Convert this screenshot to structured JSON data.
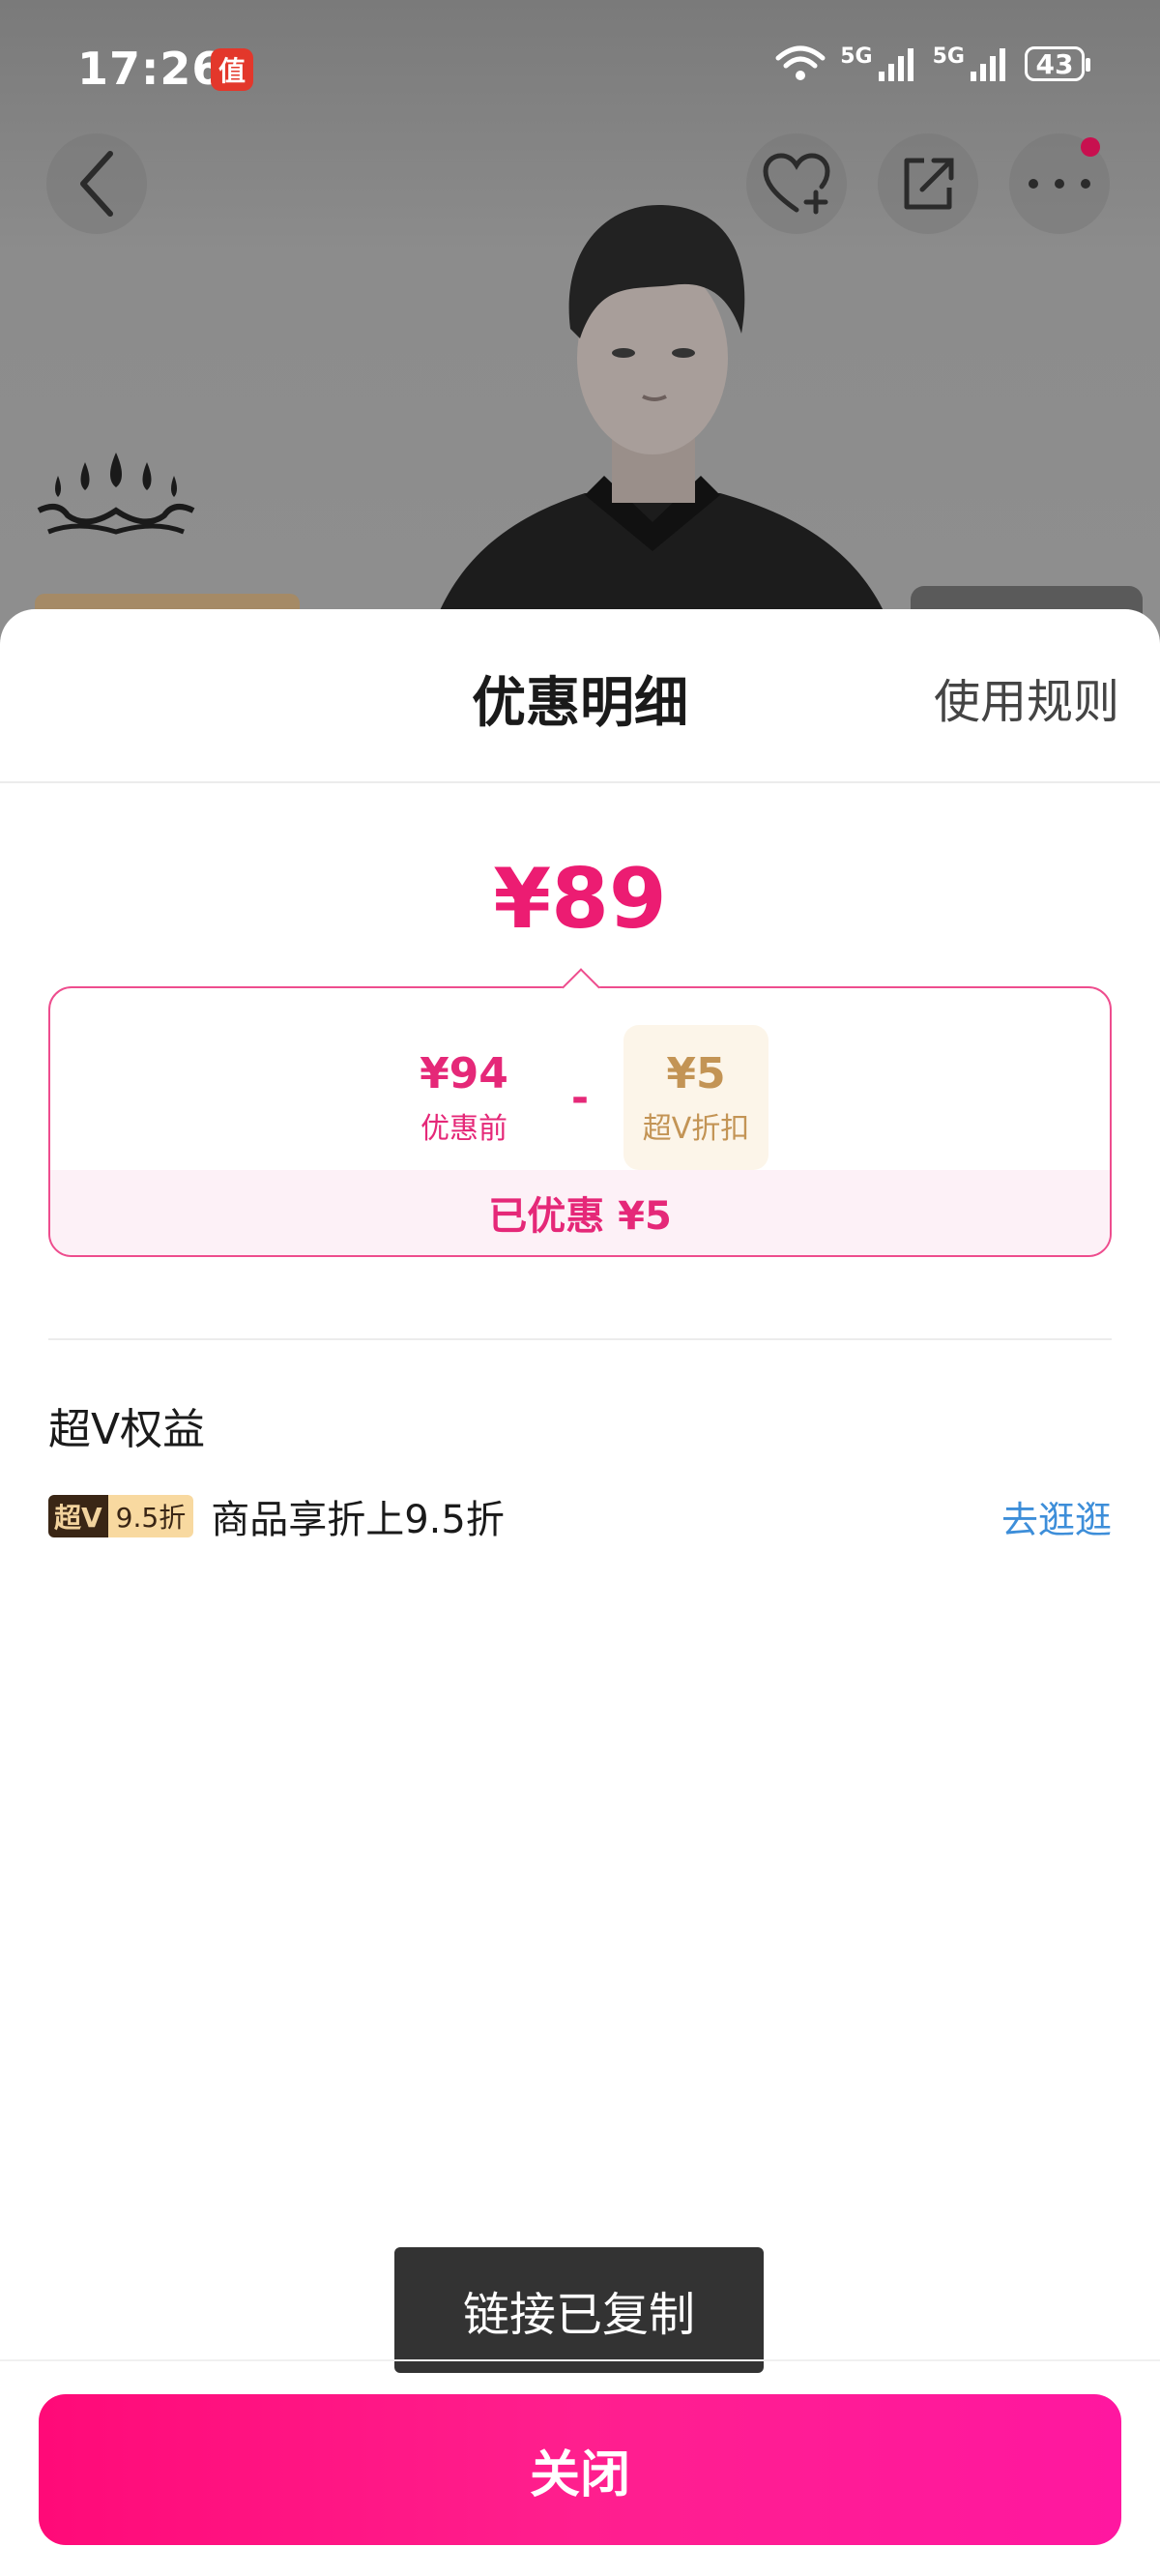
{
  "status_bar": {
    "time": "17:26",
    "app_badge": "值",
    "signal_1_label": "5G",
    "signal_2_label": "5G",
    "battery": "43"
  },
  "top_nav": {
    "icons": [
      "back-icon",
      "favorite-add-icon",
      "share-icon",
      "more-icon"
    ]
  },
  "sheet": {
    "title": "优惠明细",
    "rules_link": "使用规则",
    "final_price": "¥89",
    "breakdown": {
      "original_value": "¥94",
      "original_label": "优惠前",
      "operator": "-",
      "discount_value": "¥5",
      "discount_label": "超V折扣",
      "saved_text": "已优惠 ¥5"
    },
    "section_title": "超V权益",
    "benefit": {
      "tag_dark": "超V",
      "tag_light": "9.5折",
      "text": "商品享折上9.5折",
      "link": "去逛逛"
    },
    "close_button": "关闭"
  },
  "toast": "链接已复制",
  "colors": {
    "accent": "#ec1c72",
    "gold": "#c39455",
    "link_blue": "#3d8ed9"
  }
}
